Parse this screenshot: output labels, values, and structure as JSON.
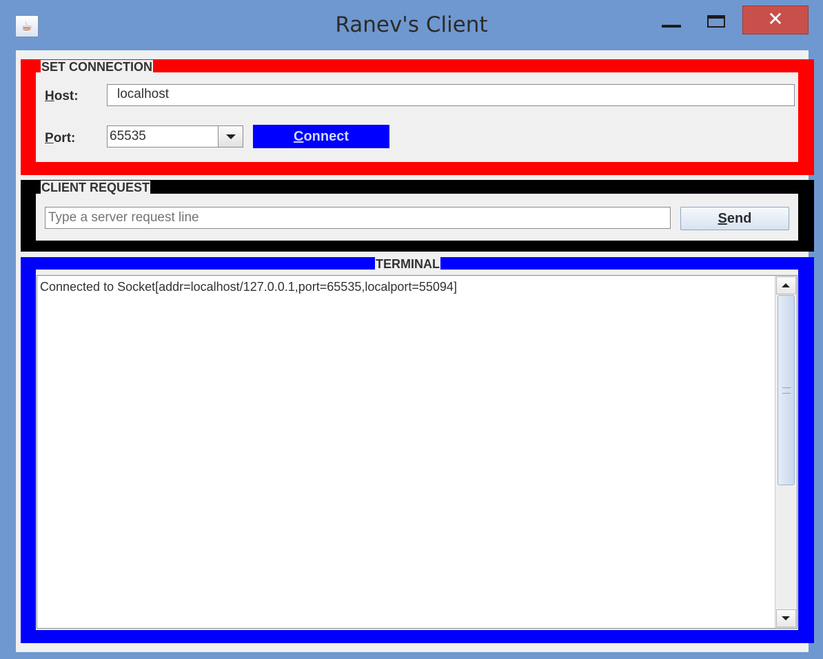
{
  "window": {
    "title": "Ranev's Client",
    "close_glyph": "✕"
  },
  "set_connection": {
    "title": "SET CONNECTION",
    "border_color": "#ff0000",
    "host_label_mnemonic": "H",
    "host_label_rest": "ost:",
    "host_value": "localhost",
    "port_label_mnemonic": "P",
    "port_label_rest": "ort:",
    "port_value": "65535",
    "connect_mnemonic": "C",
    "connect_rest": "onnect",
    "connect_color": "#0000ff"
  },
  "client_request": {
    "title": "CLIENT REQUEST",
    "border_color": "#000000",
    "placeholder": "Type a server request line",
    "send_mnemonic": "S",
    "send_rest": "end"
  },
  "terminal": {
    "title": "TERMINAL",
    "border_color": "#0000ff",
    "lines": [
      "Connected to Socket[addr=localhost/127.0.0.1,port=65535,localport=55094]"
    ]
  }
}
